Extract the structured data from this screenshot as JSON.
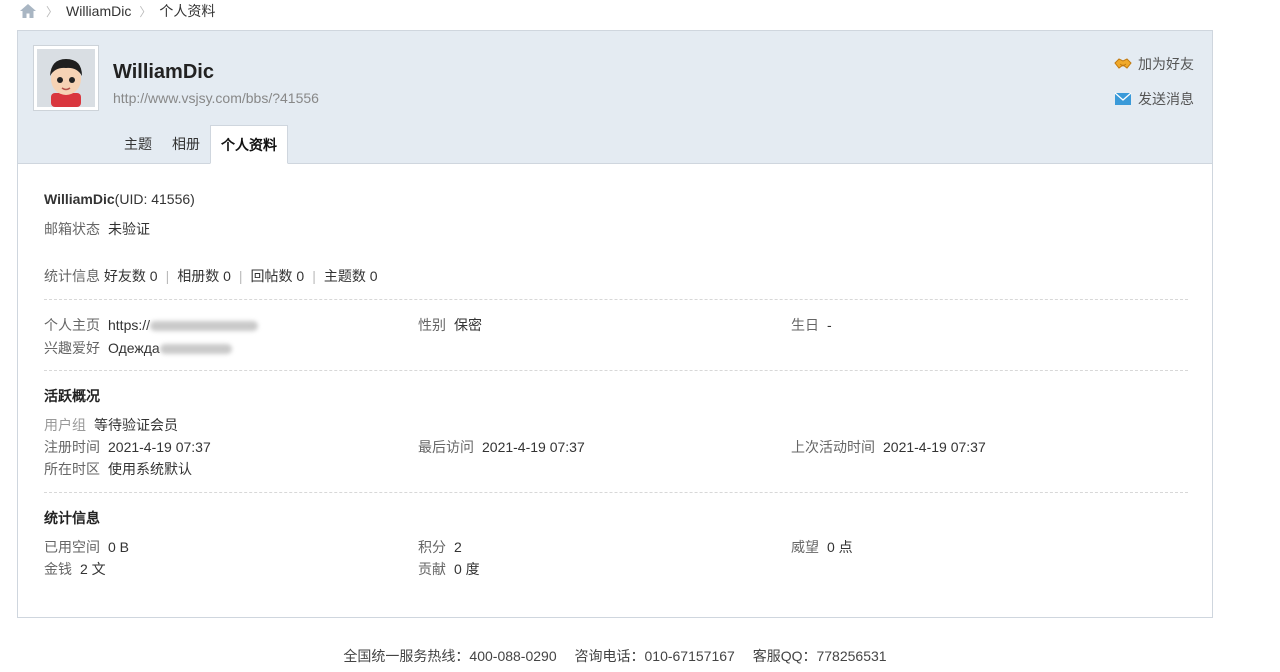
{
  "breadcrumb": {
    "home_icon": "home-icon",
    "user": "WilliamDic",
    "current": "个人资料"
  },
  "profile": {
    "name": "WilliamDic",
    "url": "http://www.vsjsy.com/bbs/?41556",
    "avatar_icon": "avatar-cartoon-boy"
  },
  "actions": {
    "add_friend": "加为好友",
    "send_message": "发送消息"
  },
  "tabs": [
    {
      "label": "主题"
    },
    {
      "label": "相册"
    },
    {
      "label": "个人资料"
    }
  ],
  "basic": {
    "name": "WilliamDic",
    "uid": "(UID: 41556)",
    "email_label": "邮箱状态",
    "email_value": "未验证",
    "stats_label": "统计信息",
    "friends": "好友数 0",
    "albums": "相册数 0",
    "replies": "回帖数 0",
    "threads": "主题数 0"
  },
  "personal": {
    "homepage_label": "个人主页",
    "homepage_value": "https://",
    "gender_label": "性别",
    "gender_value": "保密",
    "birthday_label": "生日",
    "birthday_value": "-",
    "hobby_label": "兴趣爱好",
    "hobby_value": "Одежда"
  },
  "activity": {
    "title": "活跃概况",
    "group_label": "用户组",
    "group_value": "等待验证会员",
    "reg_label": "注册时间",
    "reg_value": "2021-4-19 07:37",
    "last_visit_label": "最后访问",
    "last_visit_value": "2021-4-19 07:37",
    "last_active_label": "上次活动时间",
    "last_active_value": "2021-4-19 07:37",
    "tz_label": "所在时区",
    "tz_value": "使用系统默认"
  },
  "statistics": {
    "title": "统计信息",
    "space_label": "已用空间",
    "space_value": "0 B",
    "points_label": "积分",
    "points_value": "2",
    "prestige_label": "威望",
    "prestige_value": "0 点",
    "money_label": "金钱",
    "money_value": "2 文",
    "contrib_label": "贡献",
    "contrib_value": "0 度"
  },
  "footer": {
    "hotline": "全国统一服务热线：400-088-0290",
    "phone": "咨询电话：010-67157167",
    "qq": "客服QQ：778256531"
  },
  "colors": {
    "header_bg": "#e4ebf2",
    "border": "#cfd6de",
    "friend_icon": "#e6a020",
    "mail_icon": "#3a9ad9"
  }
}
